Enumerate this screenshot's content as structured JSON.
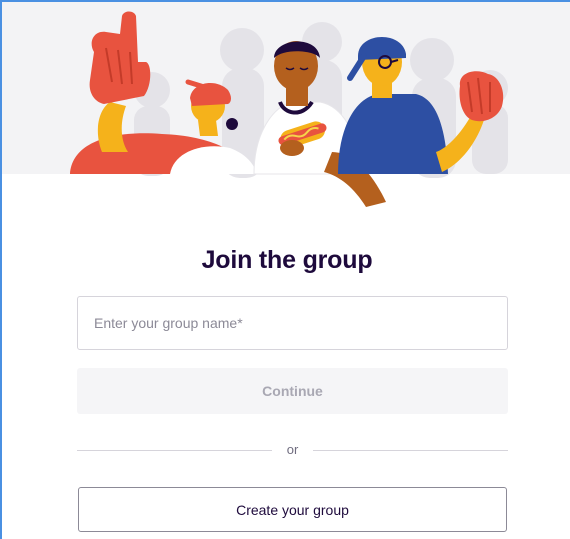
{
  "join": {
    "title": "Join the group",
    "group_name_placeholder": "Enter your group name*",
    "group_name_value": "",
    "continue_label": "Continue",
    "divider_text": "or",
    "create_label": "Create your group"
  },
  "colors": {
    "primary_text": "#1e0a3c",
    "frame_border": "#4a90e2",
    "hero_background": "#f3f3f5",
    "foam_finger": "#e8533f",
    "jersey_blue": "#2d4fa3",
    "skin_yellow": "#f5b21b",
    "skin_brown": "#b4601e"
  },
  "illustration": {
    "subjects": [
      "foam-finger-fan",
      "hot-dog-fan",
      "glove-fan"
    ]
  }
}
